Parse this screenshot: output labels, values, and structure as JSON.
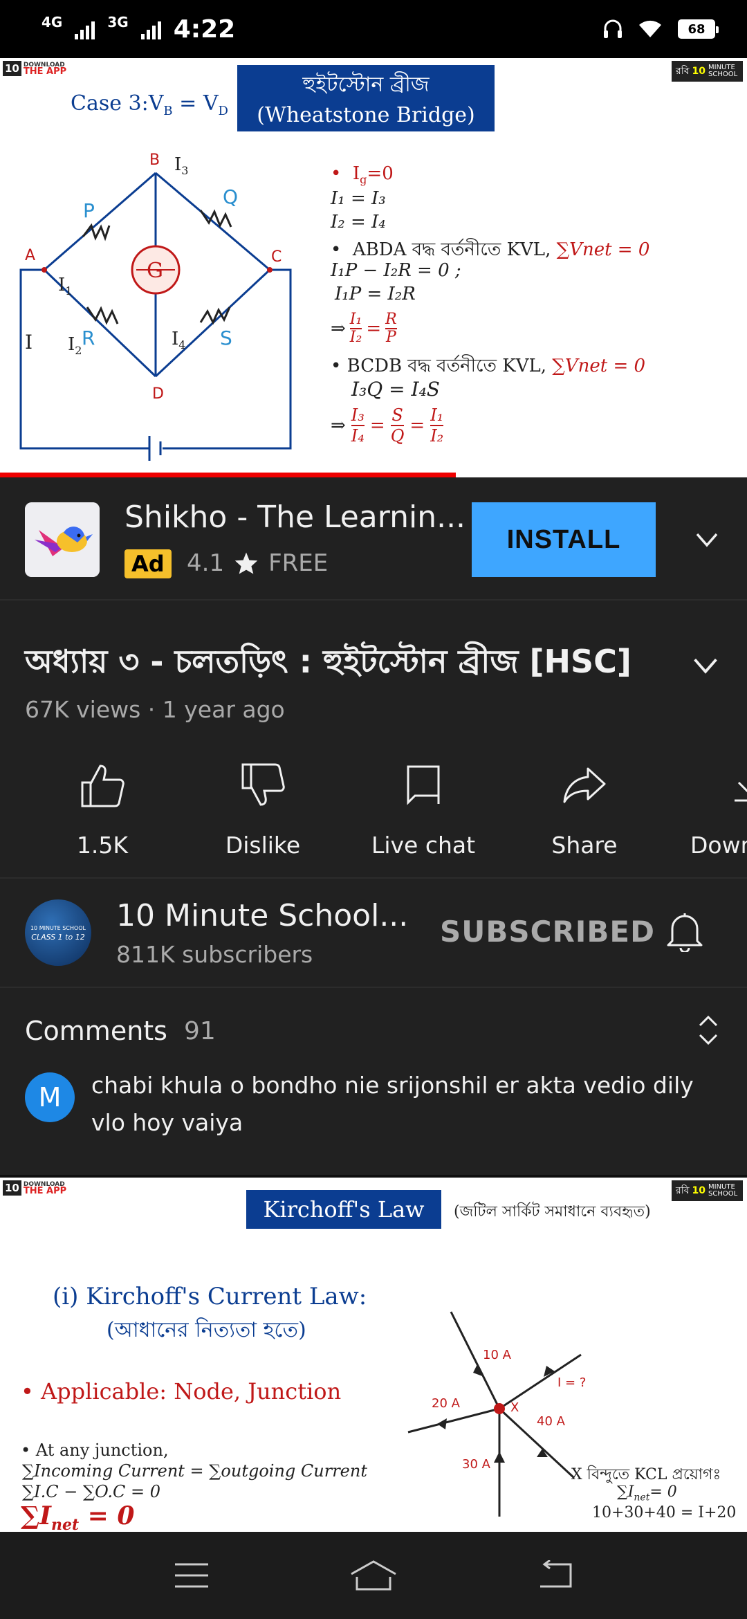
{
  "status_bar": {
    "net1": "4G",
    "net2": "3G",
    "time": "4:22",
    "battery": "68"
  },
  "video": {
    "logo_left_top": "DOWNLOAD",
    "logo_left_bottom": "THE APP",
    "logo_left_badge": "10",
    "logo_right_text": "রবি",
    "logo_right_brand": "10",
    "logo_right_sub": "MINUTE SCHOOL",
    "slide_title_bn": "হুইটস্টোন ব্রীজ",
    "slide_title_en": "(Wheatstone Bridge)",
    "case_label": "Case 3:V",
    "case_eq": "= V",
    "sub_b": "B",
    "sub_d": "D",
    "node_a": "A",
    "node_b": "B",
    "node_c": "C",
    "node_d": "D",
    "res_p": "P",
    "res_q": "Q",
    "res_r": "R",
    "res_s": "S",
    "galv": "G",
    "cur_i": "I",
    "cur_i1": "I",
    "cur_i2": "I",
    "cur_i3": "I",
    "cur_i4": "I",
    "idx1": "1",
    "idx2": "2",
    "idx3": "3",
    "idx4": "4",
    "line1": "I",
    "line1b": "=0",
    "line1sub": "g",
    "line2": "I₁ = I₃",
    "line3": "I₂ = I₄",
    "line4": "ABDA বদ্ধ বর্তনীতে KVL,",
    "line4b": "∑Vnet = 0",
    "line5": "I₁P − I₂R = 0 ;",
    "line6": "I₁P = I₂R",
    "line8": "BCDB বদ্ধ বর্তনীতে KVL,",
    "line8b": "∑Vnet = 0",
    "line9": "I₃Q = I₄S",
    "arrow": "⇒",
    "eqsign": "=",
    "frac1_num": "I₁",
    "frac1_den": "I₂",
    "frac2_num": "R",
    "frac2_den": "P",
    "frac3_num": "I₃",
    "frac3_den": "I₄",
    "frac4_num": "S",
    "frac4_den": "Q",
    "frac5_num": "I₁",
    "frac5_den": "I₂",
    "progress_fraction": 0.61
  },
  "ad": {
    "title": "Shikho - The Learnin...",
    "badge": "Ad",
    "rating": "4.1",
    "price": "FREE",
    "install_label": "INSTALL"
  },
  "info": {
    "title": "অধ্যায় ৩ - চলতড়িৎ : হুইটস্টোন ব্রীজ [HSC]",
    "meta": "67K views · 1 year ago",
    "actions": [
      {
        "label": "1.5K"
      },
      {
        "label": "Dislike"
      },
      {
        "label": "Live chat"
      },
      {
        "label": "Share"
      },
      {
        "label": "Down"
      }
    ]
  },
  "channel": {
    "avatar_text1": "10 MINUTE SCHOOL",
    "avatar_text2": "CLASS 1 to 12",
    "name": "10 Minute School...",
    "subs": "811K subscribers",
    "subscribed_label": "SUBSCRIBED"
  },
  "comments": {
    "header": "Comments",
    "count": "91",
    "first_avatar": "M",
    "first_text": "chabi khula o bondho nie srijonshil er akta vedio dily vlo hoy vaiya"
  },
  "next_video": {
    "logo_left_top": "DOWNLOAD",
    "logo_left_bottom": "THE APP",
    "logo_left_badge": "10",
    "logo_right_text": "রবি",
    "logo_right_brand": "10",
    "logo_right_sub": "MINUTE SCHOOL",
    "title": "Kirchoff's Law",
    "title_note": "(জটিল সার্কিট সমাধানে ব্যবহৃত)",
    "heading1": "(i) Kirchoff's Current Law:",
    "heading2": "(আধানের নিত্যতা হতে)",
    "bullet1": "• Applicable: Node, Junction",
    "bullet2": "• At any junction,",
    "eq1": "∑Incoming Current = ∑outgoing Current",
    "eq2": "∑I.C − ∑O.C = 0",
    "eq3": "∑I",
    "eq3sub": "net",
    "eq3b": "= 0",
    "d_10a": "10 A",
    "d_20a": "20 A",
    "d_30a": "30 A",
    "d_40a": "40 A",
    "d_iq": "I = ?",
    "d_x": "X",
    "note1": "X বিন্দুতে KCL প্রয়োগঃ",
    "note2": "∑I",
    "note2sub": "net",
    "note2b": "= 0",
    "note3": "10+30+40 = I+20"
  }
}
